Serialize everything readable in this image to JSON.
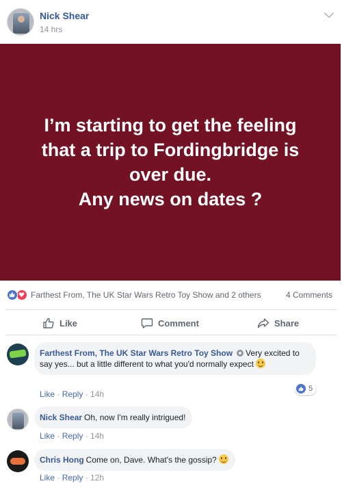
{
  "post": {
    "author": "Nick Shear",
    "time": "14 hrs",
    "background_color": "#721224",
    "text_lines": [
      "I’m starting to get the feeling",
      "that a trip to Fordingbridge is",
      "over due.",
      "Any news on dates ?"
    ]
  },
  "reactions": {
    "summary": "Farthest From, The UK Star Wars Retro Toy Show and 2 others",
    "comments_count": "4 Comments"
  },
  "actions": {
    "like": "Like",
    "comment": "Comment",
    "share": "Share"
  },
  "comments": [
    {
      "author": "Farthest From, The UK Star Wars Retro Toy Show",
      "text": "Very excited to say yes... but a little different to what you'd normally expect",
      "like": "Like",
      "reply": "Reply",
      "time": "14h",
      "reaction_count": "5"
    },
    {
      "author": "Nick Shear",
      "text": "Oh, now I'm really intrigued!",
      "like": "Like",
      "reply": "Reply",
      "time": "14h"
    },
    {
      "author": "Chris Hong",
      "text": "Come on, Dave. What's the gossip?",
      "like": "Like",
      "reply": "Reply",
      "time": "12h"
    }
  ],
  "colors": {
    "link_blue": "#365899",
    "meta_grey": "#90949c",
    "like_blue": "#4d75c7",
    "love_red": "#f33e58"
  }
}
